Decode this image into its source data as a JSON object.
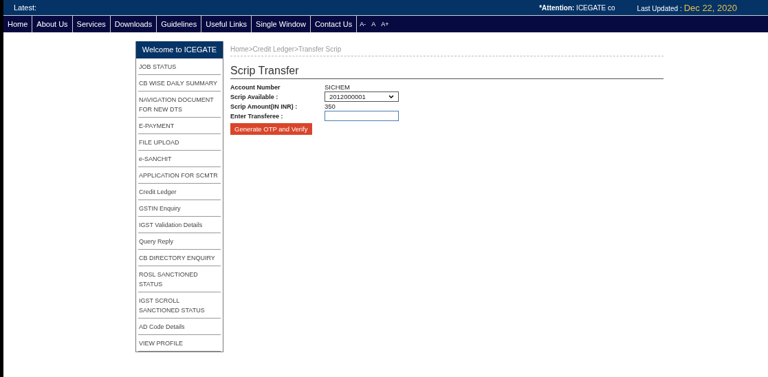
{
  "ticker": {
    "label": "Latest:",
    "attention_label": "*Attention:",
    "attention_text": "ICEGATE co",
    "updated_label": "Last Updated :",
    "updated_date": "Dec 22, 2020"
  },
  "nav": [
    "Home",
    "About Us",
    "Services",
    "Downloads",
    "Guidelines",
    "Useful Links",
    "Single Window",
    "Contact Us"
  ],
  "font_sizes": [
    "A-",
    "A",
    "A+"
  ],
  "sidebar": {
    "title": "Welcome to ICEGATE",
    "items": [
      {
        "label": "JOB STATUS"
      },
      {
        "label": "CB WISE DAILY SUMMARY"
      },
      {
        "label": "NAVIGATION DOCUMENT FOR NEW DTS"
      },
      {
        "label": "E-PAYMENT"
      },
      {
        "label": "FILE UPLOAD"
      },
      {
        "label": "e-SANCHIT"
      },
      {
        "label": "APPLICATION FOR SCMTR"
      },
      {
        "label": "Credit Ledger"
      },
      {
        "label": "GSTIN Enquiry"
      },
      {
        "label": "IGST Validation Details"
      },
      {
        "label": "Query Reply"
      },
      {
        "label": "CB DIRECTORY ENQUIRY"
      },
      {
        "label": "ROSL SANCTIONED STATUS"
      },
      {
        "label": "IGST SCROLL SANCTIONED STATUS"
      },
      {
        "label": "AD Code Details"
      },
      {
        "label": "VIEW PROFILE"
      }
    ]
  },
  "breadcrumb": [
    "Home",
    ">Credit Ledger",
    ">Transfer Scrip"
  ],
  "form": {
    "title": "Scrip Transfer",
    "fields": [
      {
        "kind": "text",
        "label": "Account Number",
        "value": "SICHEM"
      },
      {
        "kind": "select",
        "label": "Scrip Available :",
        "value": "2012000001"
      },
      {
        "kind": "text",
        "label": "Scrip Amount(IN INR) :",
        "value": "350"
      },
      {
        "kind": "input",
        "label": "Enter Transferee :"
      }
    ],
    "button": "Generate OTP and Verify"
  }
}
